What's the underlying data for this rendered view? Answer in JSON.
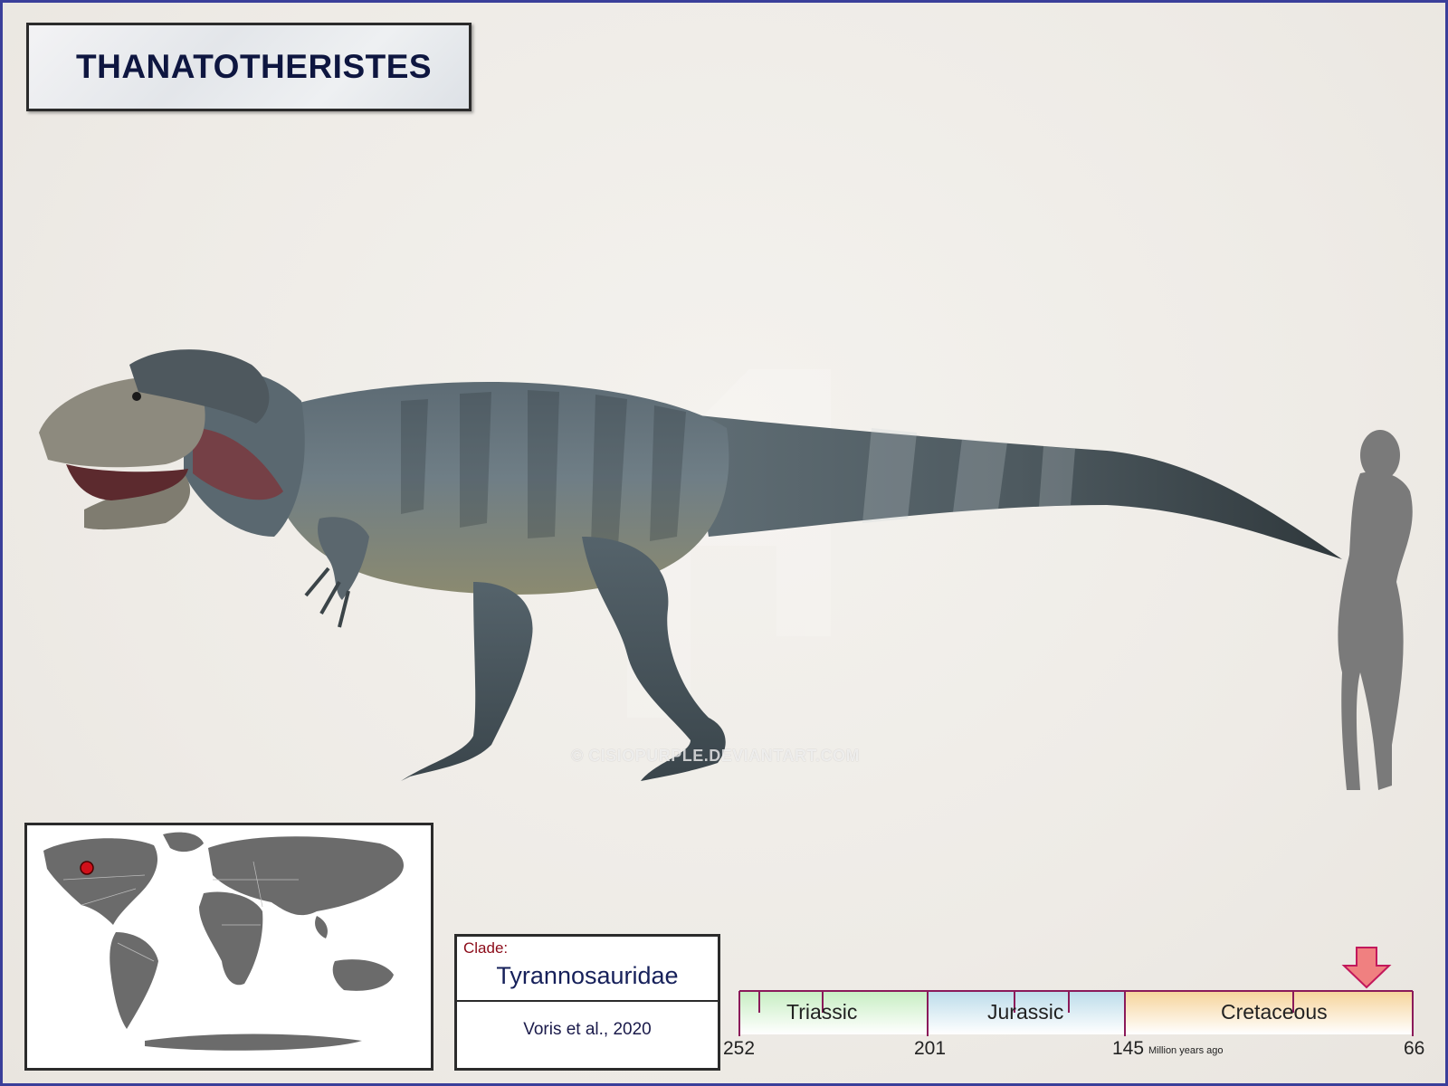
{
  "title": "THANATOTHERISTES",
  "watermark": "© CISIOPURPLE.DEVIANTART.COM",
  "clade": {
    "label": "Clade:",
    "name": "Tyrannosauridae",
    "author": "Voris et al., 2020"
  },
  "timeline": {
    "periods": [
      "Triassic",
      "Jurassic",
      "Cretaceous"
    ],
    "ticks": [
      "252",
      "201",
      "145",
      "66"
    ],
    "unit": "Million years ago",
    "marker_mya": 77
  },
  "map": {
    "marker_region": "western North America",
    "marker_color": "#d0101a"
  },
  "colors": {
    "border": "#3a3f9a",
    "title_text": "#0e1640",
    "triassic": "#c7eec2",
    "jurassic": "#bcdcea",
    "cretaceous": "#f6d39a",
    "timeline_frame": "#8b1a5a",
    "arrow": "#f08080"
  }
}
